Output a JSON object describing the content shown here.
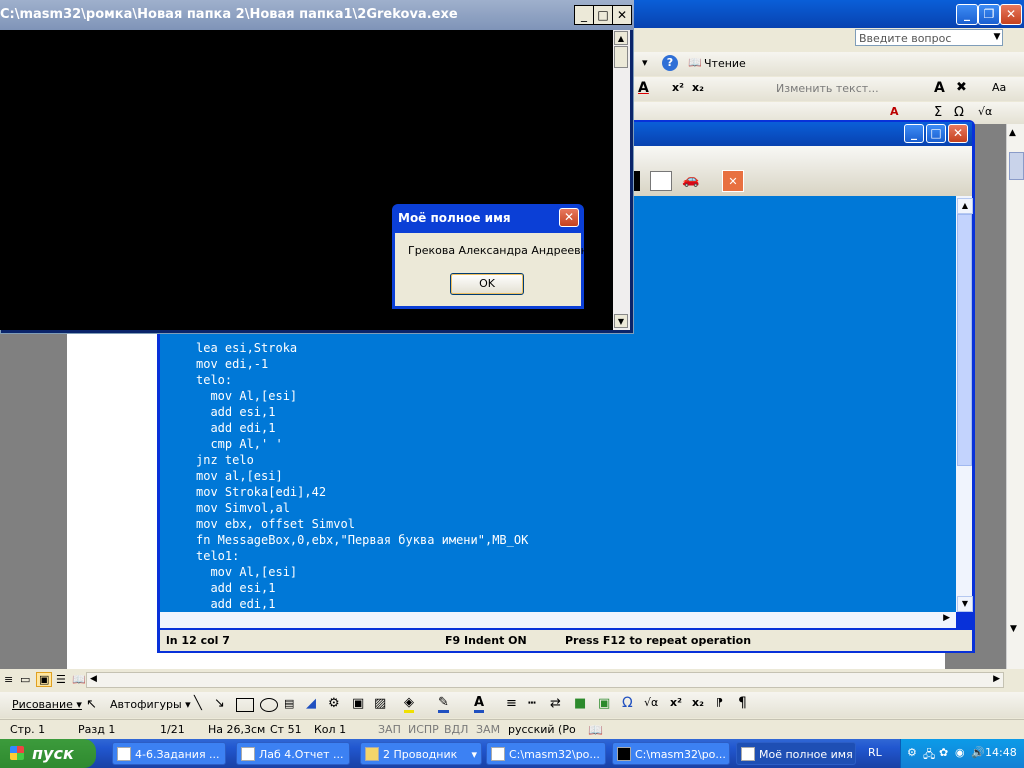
{
  "word": {
    "ask_placeholder": "Введите вопрос",
    "read_label": "Чтение",
    "change_text_label": "Изменить текст...",
    "statusbar": {
      "page": "Стр. 1",
      "section": "Разд 1",
      "pages": "1/21",
      "at": "На 26,3см",
      "line": "Ст 51",
      "col": "Кол 1",
      "rec": "ЗАП",
      "trk": "ИСПР",
      "ext": "ВДЛ",
      "ovr": "ЗАМ",
      "lang": "русский (Ро"
    },
    "drawbar": {
      "draw_label": "Рисование ▾",
      "autoshapes_label": "Автофигуры ▾"
    }
  },
  "console": {
    "title": "C:\\masm32\\ромка\\Новая папка 2\\Новая папка1\\2Grekova.exe"
  },
  "messagebox": {
    "title": "Моё полное имя",
    "text": "Грекова Александра Андреевна",
    "ok_label": "OK"
  },
  "editor": {
    "code_lines": [
      "lea esi,Stroka",
      "mov edi,-1",
      "telo:",
      "  mov Al,[esi]",
      "  add esi,1",
      "  add edi,1",
      "  cmp Al,' '",
      "jnz telo",
      "mov al,[esi]",
      "mov Stroka[edi],42",
      "mov Simvol,al",
      "mov ebx, offset Simvol",
      "fn MessageBox,0,ebx,\"Первая буква имени\",MB_OK",
      "telo1:",
      "  mov Al,[esi]",
      "  add esi,1",
      "  add edi,1"
    ],
    "status": {
      "position": "ln 12 col 7",
      "indent": "F9 Indent ON",
      "repeat": "Press F12 to repeat operation"
    }
  },
  "taskbar": {
    "start_label": "пуск",
    "tasks": [
      "4-6.Задания ...",
      "Лаб 4.Отчет ...",
      "2 Проводник",
      "C:\\masm32\\ро...",
      "C:\\masm32\\ро...",
      "Моё полное имя"
    ],
    "lang": "RL",
    "clock": "14:48"
  }
}
